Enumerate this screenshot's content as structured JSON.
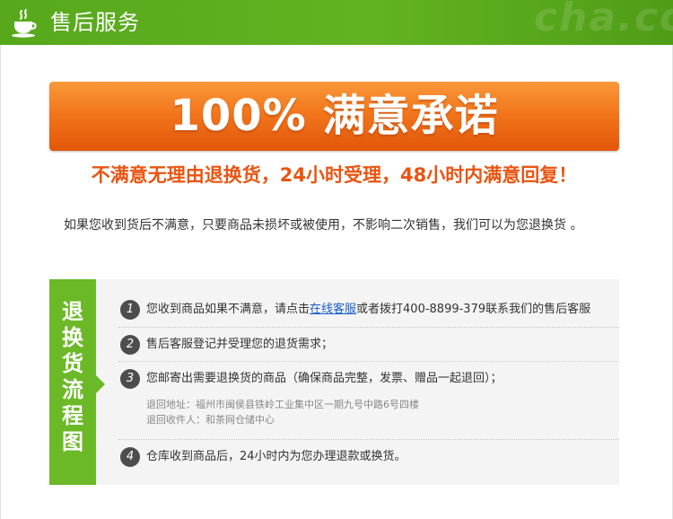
{
  "header": {
    "title": "售后服务",
    "icon": "tea-cup-icon",
    "watermark": "cha.co echa",
    "colors": {
      "bg": "#5aab1f"
    }
  },
  "banner": {
    "text": "100% 满意承诺",
    "color": "#f2761c"
  },
  "promise": {
    "text": "不满意无理由退换货，24小时受理，48小时内满意回复！",
    "color": "#e95511"
  },
  "intro": {
    "text": "如果您收到货后不满意，只要商品未损坏或被使用，不影响二次销售，我们可以为您退换货 。"
  },
  "process": {
    "tab_label": "退换货流程图",
    "tab_color": "#6cb928",
    "steps": [
      {
        "number": "1",
        "before": "您收到商品如果不满意，请点击",
        "link": "在线客服",
        "after": "或者拨打400-8899-379联系我们的售后客服"
      },
      {
        "number": "2",
        "text": "售后客服登记并受理您的退货需求；"
      },
      {
        "number": "3",
        "text": "您邮寄出需要退换货的商品（确保商品完整，发票、赠品一起退回）；",
        "address": "退回地址：福州市闽侯县铁岭工业集中区一期九号中路6号四楼",
        "receiver": "退回收件人：和茶网仓储中心"
      },
      {
        "number": "4",
        "text": "仓库收到商品后，24小时内为您办理退款或换货。"
      }
    ]
  }
}
